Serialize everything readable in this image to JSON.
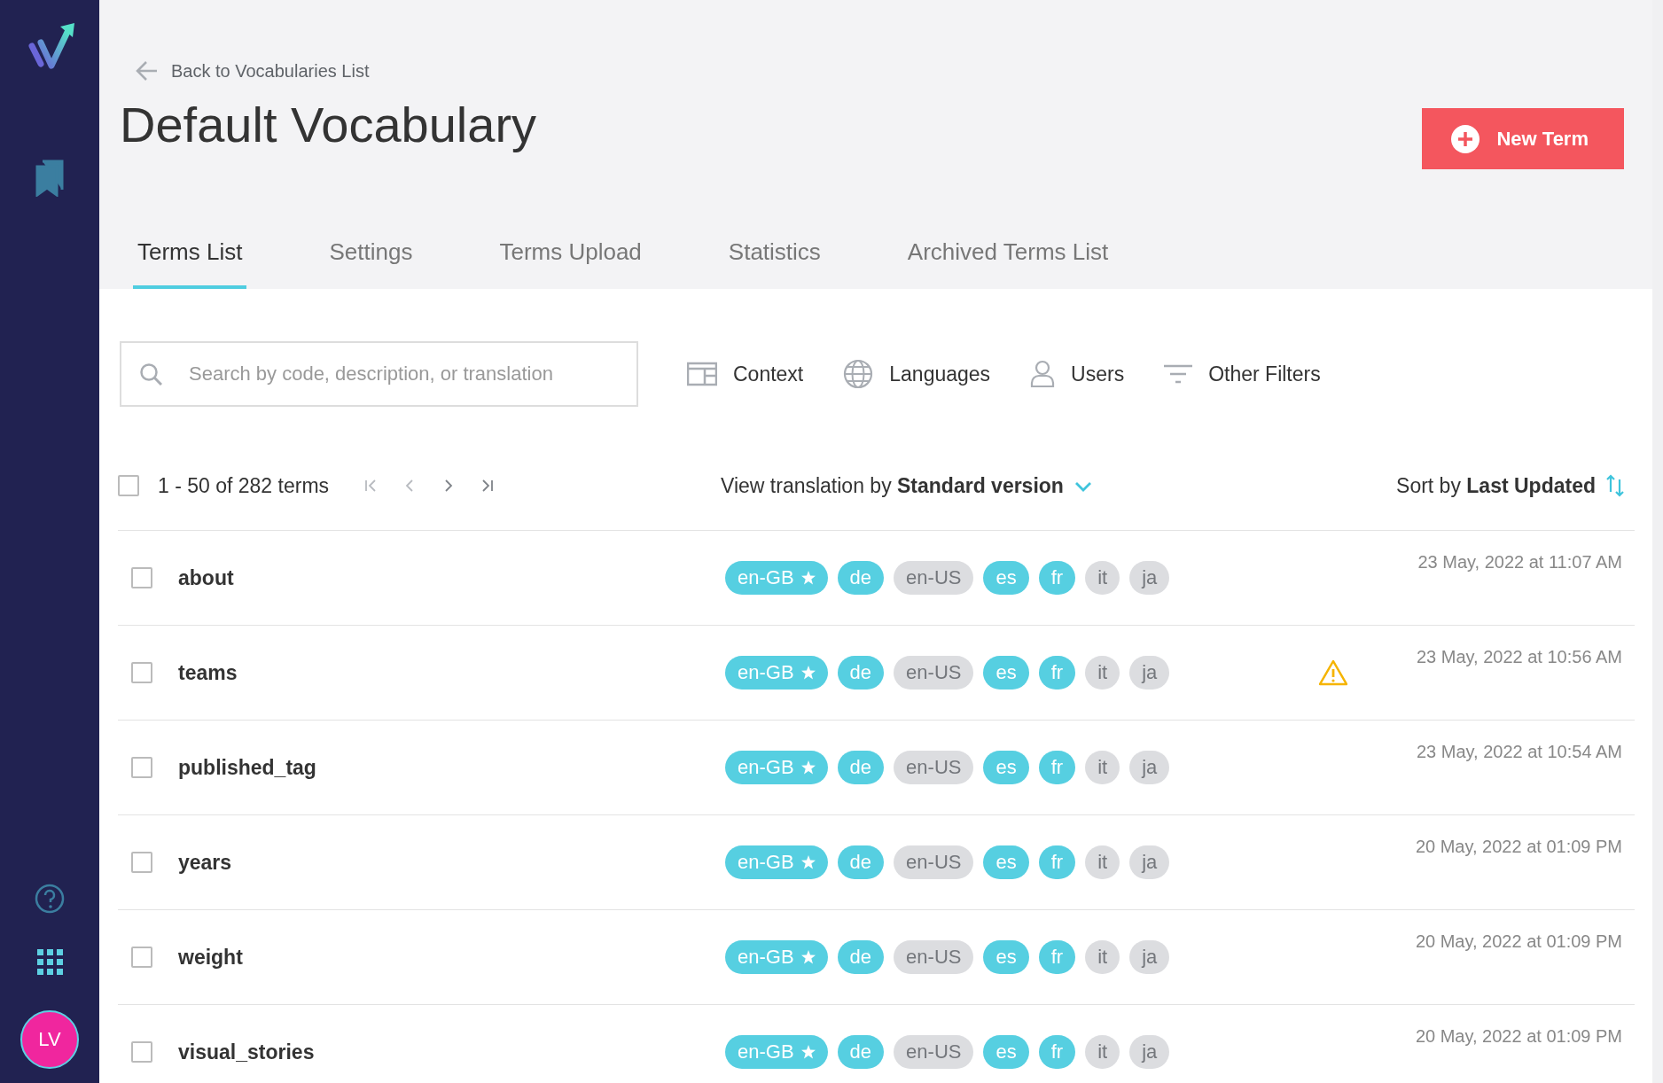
{
  "sidebar": {
    "avatar": "LV"
  },
  "header": {
    "back_link": "Back to Vocabularies List",
    "title": "Default Vocabulary",
    "new_button": "New Term"
  },
  "tabs": [
    {
      "label": "Terms List",
      "selected": true
    },
    {
      "label": "Settings",
      "selected": false
    },
    {
      "label": "Terms Upload",
      "selected": false
    },
    {
      "label": "Statistics",
      "selected": false
    },
    {
      "label": "Archived Terms List",
      "selected": false
    }
  ],
  "search": {
    "placeholder": "Search by code, description, or translation"
  },
  "filters": [
    {
      "kind": "context",
      "label": "Context"
    },
    {
      "kind": "languages",
      "label": "Languages"
    },
    {
      "kind": "users",
      "label": "Users"
    },
    {
      "kind": "other",
      "label": "Other Filters"
    }
  ],
  "list_header": {
    "checked": false,
    "range": "1 - 50 of 282 terms",
    "view_prefix": "View translation by",
    "view_value": "Standard version",
    "sort_prefix": "Sort by",
    "sort_value": "Last Updated"
  },
  "rows": [
    {
      "name": "about",
      "checked": false,
      "warning": false,
      "date": "23 May, 2022 at 11:07 AM",
      "languages": [
        {
          "code": "en-GB",
          "default": true,
          "on": true
        },
        {
          "code": "de",
          "default": false,
          "on": true
        },
        {
          "code": "en-US",
          "default": false,
          "on": false
        },
        {
          "code": "es",
          "default": false,
          "on": true
        },
        {
          "code": "fr",
          "default": false,
          "on": true
        },
        {
          "code": "it",
          "default": false,
          "on": false
        },
        {
          "code": "ja",
          "default": false,
          "on": false
        }
      ]
    },
    {
      "name": "teams",
      "checked": false,
      "warning": true,
      "date": "23 May, 2022 at 10:56 AM",
      "languages": [
        {
          "code": "en-GB",
          "default": true,
          "on": true
        },
        {
          "code": "de",
          "default": false,
          "on": true
        },
        {
          "code": "en-US",
          "default": false,
          "on": false
        },
        {
          "code": "es",
          "default": false,
          "on": true
        },
        {
          "code": "fr",
          "default": false,
          "on": true
        },
        {
          "code": "it",
          "default": false,
          "on": false
        },
        {
          "code": "ja",
          "default": false,
          "on": false
        }
      ]
    },
    {
      "name": "published_tag",
      "checked": false,
      "warning": false,
      "date": "23 May, 2022 at 10:54 AM",
      "languages": [
        {
          "code": "en-GB",
          "default": true,
          "on": true
        },
        {
          "code": "de",
          "default": false,
          "on": true
        },
        {
          "code": "en-US",
          "default": false,
          "on": false
        },
        {
          "code": "es",
          "default": false,
          "on": true
        },
        {
          "code": "fr",
          "default": false,
          "on": true
        },
        {
          "code": "it",
          "default": false,
          "on": false
        },
        {
          "code": "ja",
          "default": false,
          "on": false
        }
      ]
    },
    {
      "name": "years",
      "checked": false,
      "warning": false,
      "date": "20 May, 2022 at 01:09 PM",
      "languages": [
        {
          "code": "en-GB",
          "default": true,
          "on": true
        },
        {
          "code": "de",
          "default": false,
          "on": true
        },
        {
          "code": "en-US",
          "default": false,
          "on": false
        },
        {
          "code": "es",
          "default": false,
          "on": true
        },
        {
          "code": "fr",
          "default": false,
          "on": true
        },
        {
          "code": "it",
          "default": false,
          "on": false
        },
        {
          "code": "ja",
          "default": false,
          "on": false
        }
      ]
    },
    {
      "name": "weight",
      "checked": false,
      "warning": false,
      "date": "20 May, 2022 at 01:09 PM",
      "languages": [
        {
          "code": "en-GB",
          "default": true,
          "on": true
        },
        {
          "code": "de",
          "default": false,
          "on": true
        },
        {
          "code": "en-US",
          "default": false,
          "on": false
        },
        {
          "code": "es",
          "default": false,
          "on": true
        },
        {
          "code": "fr",
          "default": false,
          "on": true
        },
        {
          "code": "it",
          "default": false,
          "on": false
        },
        {
          "code": "ja",
          "default": false,
          "on": false
        }
      ]
    },
    {
      "name": "visual_stories",
      "checked": false,
      "warning": false,
      "date": "20 May, 2022 at 01:09 PM",
      "languages": [
        {
          "code": "en-GB",
          "default": true,
          "on": true
        },
        {
          "code": "de",
          "default": false,
          "on": true
        },
        {
          "code": "en-US",
          "default": false,
          "on": false
        },
        {
          "code": "es",
          "default": false,
          "on": true
        },
        {
          "code": "fr",
          "default": false,
          "on": true
        },
        {
          "code": "it",
          "default": false,
          "on": false
        },
        {
          "code": "ja",
          "default": false,
          "on": false
        }
      ]
    }
  ]
}
